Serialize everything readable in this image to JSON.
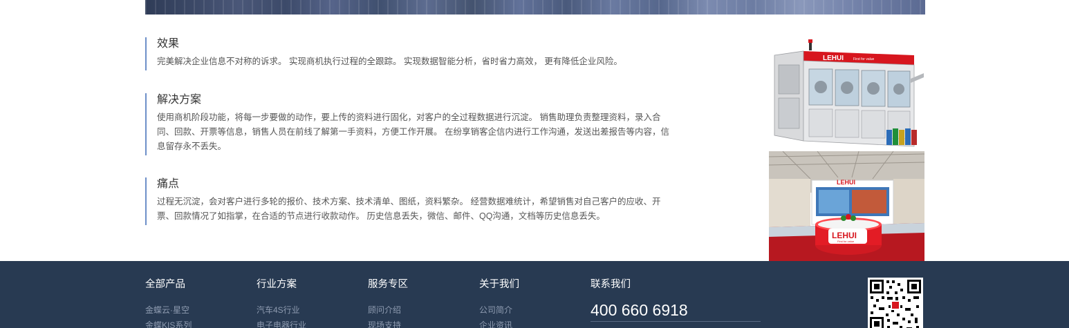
{
  "sections": [
    {
      "title": "效果",
      "text": "完美解决企业信息不对称的诉求。 实现商机执行过程的全跟踪。 实现数据智能分析，省时省力高效， 更有降低企业风险。"
    },
    {
      "title": "解决方案",
      "line1": "使用商机阶段功能，将每一步要做的动作，要上传的资料进行固化，对客户的全过程数据进行沉淀。 销售助理负责整理资料，录入合",
      "line2": "同、回款、开票等信息，销售人员在前线了解第一手资料，方便工作开展。 在纷享销客企信内进行工作沟通，发送出差报告等内容，信",
      "line3": "息留存永不丢失。"
    },
    {
      "title": "痛点",
      "line1": "过程无沉淀，会对客户进行多轮的报价、技术方案、技术清单、图纸，资料繁杂。 经营数据难统计，希望销售对自己客户的应收、开",
      "line2": "票、回款情况了如指掌，在合适的节点进行收款动作。 历史信息丢失，微信、邮件、QQ沟通，文档等历史信息丢失。"
    }
  ],
  "images": {
    "machine_brand": "LEHUI",
    "machine_slogan": "First for value",
    "booth_brand": "LEHUI",
    "booth_slogan": "First for value",
    "booth_sign": "LEHUI"
  },
  "footer": {
    "columns": [
      {
        "title": "全部产品",
        "items": [
          "金蝶云·星空",
          "金蝶KIS系列"
        ]
      },
      {
        "title": "行业方案",
        "items": [
          "汽车4S行业",
          "电子电器行业"
        ]
      },
      {
        "title": "服务专区",
        "items": [
          "顾问介绍",
          "现场支持"
        ]
      },
      {
        "title": "关于我们",
        "items": [
          "公司简介",
          "企业资讯"
        ]
      }
    ],
    "contact_title": "联系我们",
    "phone": "400 660 6918"
  },
  "colors": {
    "accent_line": "#6d8fc8",
    "footer_bg": "#283a52",
    "brand_red": "#d7161e"
  },
  "icons": [
    "qr-code-icon"
  ]
}
